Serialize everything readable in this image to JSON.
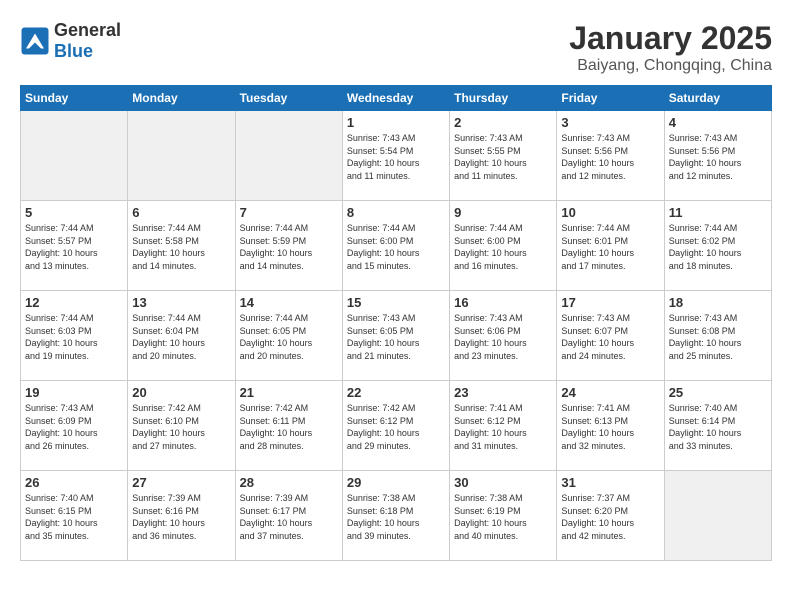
{
  "header": {
    "logo_general": "General",
    "logo_blue": "Blue",
    "title": "January 2025",
    "subtitle": "Baiyang, Chongqing, China"
  },
  "days_of_week": [
    "Sunday",
    "Monday",
    "Tuesday",
    "Wednesday",
    "Thursday",
    "Friday",
    "Saturday"
  ],
  "weeks": [
    [
      {
        "num": "",
        "info": "",
        "empty": true
      },
      {
        "num": "",
        "info": "",
        "empty": true
      },
      {
        "num": "",
        "info": "",
        "empty": true
      },
      {
        "num": "1",
        "info": "Sunrise: 7:43 AM\nSunset: 5:54 PM\nDaylight: 10 hours\nand 11 minutes.",
        "empty": false
      },
      {
        "num": "2",
        "info": "Sunrise: 7:43 AM\nSunset: 5:55 PM\nDaylight: 10 hours\nand 11 minutes.",
        "empty": false
      },
      {
        "num": "3",
        "info": "Sunrise: 7:43 AM\nSunset: 5:56 PM\nDaylight: 10 hours\nand 12 minutes.",
        "empty": false
      },
      {
        "num": "4",
        "info": "Sunrise: 7:43 AM\nSunset: 5:56 PM\nDaylight: 10 hours\nand 12 minutes.",
        "empty": false
      }
    ],
    [
      {
        "num": "5",
        "info": "Sunrise: 7:44 AM\nSunset: 5:57 PM\nDaylight: 10 hours\nand 13 minutes.",
        "empty": false
      },
      {
        "num": "6",
        "info": "Sunrise: 7:44 AM\nSunset: 5:58 PM\nDaylight: 10 hours\nand 14 minutes.",
        "empty": false
      },
      {
        "num": "7",
        "info": "Sunrise: 7:44 AM\nSunset: 5:59 PM\nDaylight: 10 hours\nand 14 minutes.",
        "empty": false
      },
      {
        "num": "8",
        "info": "Sunrise: 7:44 AM\nSunset: 6:00 PM\nDaylight: 10 hours\nand 15 minutes.",
        "empty": false
      },
      {
        "num": "9",
        "info": "Sunrise: 7:44 AM\nSunset: 6:00 PM\nDaylight: 10 hours\nand 16 minutes.",
        "empty": false
      },
      {
        "num": "10",
        "info": "Sunrise: 7:44 AM\nSunset: 6:01 PM\nDaylight: 10 hours\nand 17 minutes.",
        "empty": false
      },
      {
        "num": "11",
        "info": "Sunrise: 7:44 AM\nSunset: 6:02 PM\nDaylight: 10 hours\nand 18 minutes.",
        "empty": false
      }
    ],
    [
      {
        "num": "12",
        "info": "Sunrise: 7:44 AM\nSunset: 6:03 PM\nDaylight: 10 hours\nand 19 minutes.",
        "empty": false
      },
      {
        "num": "13",
        "info": "Sunrise: 7:44 AM\nSunset: 6:04 PM\nDaylight: 10 hours\nand 20 minutes.",
        "empty": false
      },
      {
        "num": "14",
        "info": "Sunrise: 7:44 AM\nSunset: 6:05 PM\nDaylight: 10 hours\nand 20 minutes.",
        "empty": false
      },
      {
        "num": "15",
        "info": "Sunrise: 7:43 AM\nSunset: 6:05 PM\nDaylight: 10 hours\nand 21 minutes.",
        "empty": false
      },
      {
        "num": "16",
        "info": "Sunrise: 7:43 AM\nSunset: 6:06 PM\nDaylight: 10 hours\nand 23 minutes.",
        "empty": false
      },
      {
        "num": "17",
        "info": "Sunrise: 7:43 AM\nSunset: 6:07 PM\nDaylight: 10 hours\nand 24 minutes.",
        "empty": false
      },
      {
        "num": "18",
        "info": "Sunrise: 7:43 AM\nSunset: 6:08 PM\nDaylight: 10 hours\nand 25 minutes.",
        "empty": false
      }
    ],
    [
      {
        "num": "19",
        "info": "Sunrise: 7:43 AM\nSunset: 6:09 PM\nDaylight: 10 hours\nand 26 minutes.",
        "empty": false
      },
      {
        "num": "20",
        "info": "Sunrise: 7:42 AM\nSunset: 6:10 PM\nDaylight: 10 hours\nand 27 minutes.",
        "empty": false
      },
      {
        "num": "21",
        "info": "Sunrise: 7:42 AM\nSunset: 6:11 PM\nDaylight: 10 hours\nand 28 minutes.",
        "empty": false
      },
      {
        "num": "22",
        "info": "Sunrise: 7:42 AM\nSunset: 6:12 PM\nDaylight: 10 hours\nand 29 minutes.",
        "empty": false
      },
      {
        "num": "23",
        "info": "Sunrise: 7:41 AM\nSunset: 6:12 PM\nDaylight: 10 hours\nand 31 minutes.",
        "empty": false
      },
      {
        "num": "24",
        "info": "Sunrise: 7:41 AM\nSunset: 6:13 PM\nDaylight: 10 hours\nand 32 minutes.",
        "empty": false
      },
      {
        "num": "25",
        "info": "Sunrise: 7:40 AM\nSunset: 6:14 PM\nDaylight: 10 hours\nand 33 minutes.",
        "empty": false
      }
    ],
    [
      {
        "num": "26",
        "info": "Sunrise: 7:40 AM\nSunset: 6:15 PM\nDaylight: 10 hours\nand 35 minutes.",
        "empty": false
      },
      {
        "num": "27",
        "info": "Sunrise: 7:39 AM\nSunset: 6:16 PM\nDaylight: 10 hours\nand 36 minutes.",
        "empty": false
      },
      {
        "num": "28",
        "info": "Sunrise: 7:39 AM\nSunset: 6:17 PM\nDaylight: 10 hours\nand 37 minutes.",
        "empty": false
      },
      {
        "num": "29",
        "info": "Sunrise: 7:38 AM\nSunset: 6:18 PM\nDaylight: 10 hours\nand 39 minutes.",
        "empty": false
      },
      {
        "num": "30",
        "info": "Sunrise: 7:38 AM\nSunset: 6:19 PM\nDaylight: 10 hours\nand 40 minutes.",
        "empty": false
      },
      {
        "num": "31",
        "info": "Sunrise: 7:37 AM\nSunset: 6:20 PM\nDaylight: 10 hours\nand 42 minutes.",
        "empty": false
      },
      {
        "num": "",
        "info": "",
        "empty": true
      }
    ]
  ]
}
